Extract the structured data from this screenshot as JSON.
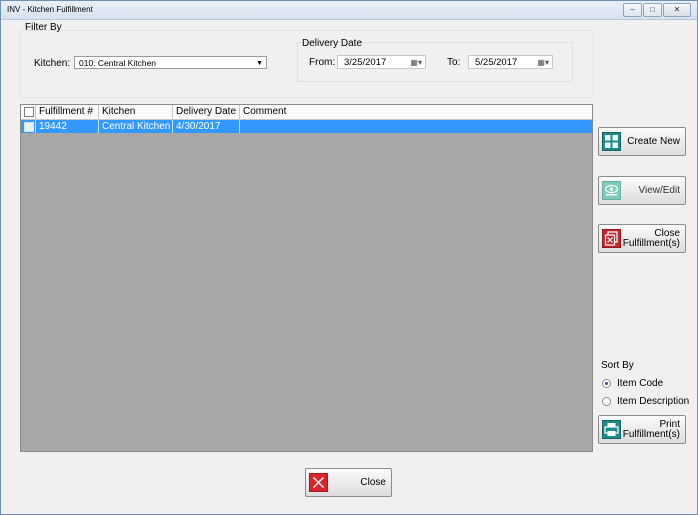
{
  "window": {
    "title": "INV - Kitchen Fulfillment",
    "controls": {
      "minimize": "‒",
      "maximize": "□",
      "close": "✕"
    }
  },
  "filter": {
    "group_label": "Filter By",
    "kitchen_label": "Kitchen:",
    "kitchen_value": "010: Central Kitchen",
    "delivery_date_label": "Delivery Date",
    "from_label": "From:",
    "from_value": "3/25/2017",
    "to_label": "To:",
    "to_value": "5/25/2017"
  },
  "grid": {
    "columns": [
      "Fulfillment #",
      "Kitchen",
      "Delivery Date",
      "Comment"
    ],
    "rows": [
      {
        "fulfillment": "19442",
        "kitchen": "Central Kitchen",
        "delivery_date": "4/30/2017",
        "comment": ""
      }
    ]
  },
  "actions": {
    "create_new": "Create New",
    "view_edit": "View/Edit",
    "close_fulfillment_line1": "Close",
    "close_fulfillment_line2": "Fulfillment(s)",
    "print_line1": "Print",
    "print_line2": "Fulfillment(s)",
    "close": "Close"
  },
  "sort": {
    "label": "Sort By",
    "options": [
      "Item Code",
      "Item Description"
    ],
    "selected": "Item Code"
  },
  "colors": {
    "selected_row": "#3399ff",
    "grid_background": "#a8a8a8",
    "teal_icon": "#1e8c8c",
    "red_icon": "#c0282d"
  },
  "icons": {
    "create_new": "add-grid-icon",
    "view_edit": "eye-icon",
    "close_fulfillment": "close-document-icon",
    "print": "printer-icon",
    "close": "red-x-icon"
  }
}
